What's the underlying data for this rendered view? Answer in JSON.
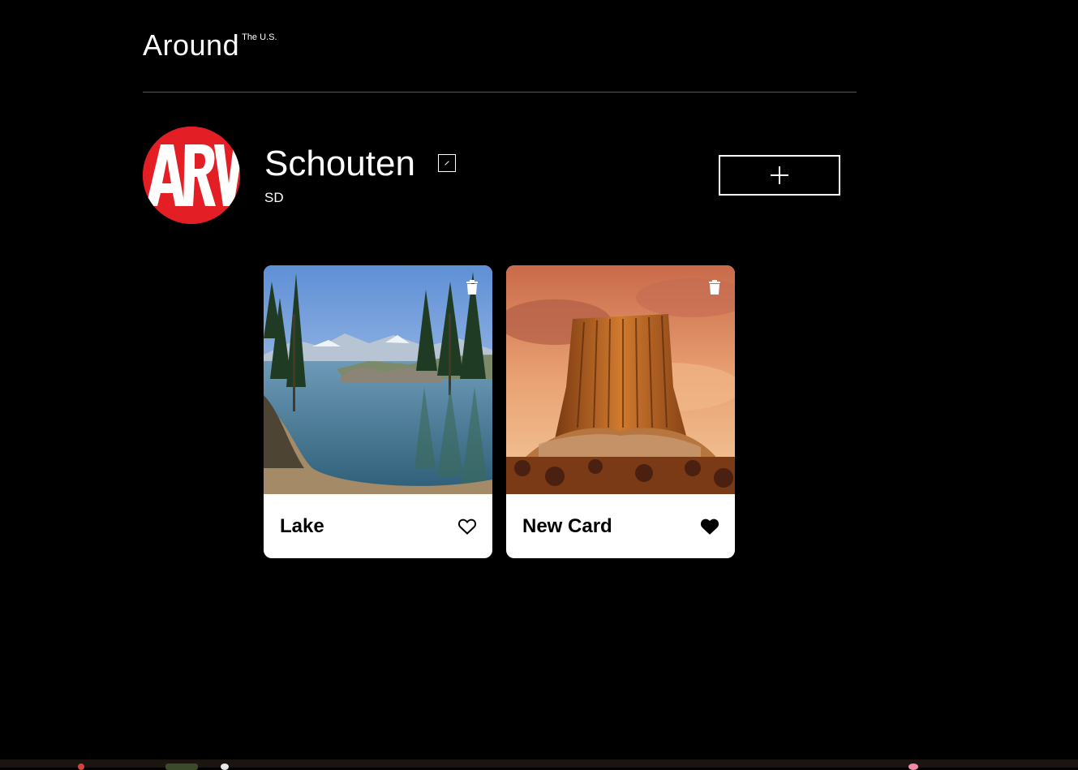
{
  "header": {
    "logo_main": "Around",
    "logo_sup": "The U.S."
  },
  "profile": {
    "name": "Schouten",
    "about": "SD",
    "avatar_text": "ARV",
    "avatar_color": "#e31e24"
  },
  "cards": [
    {
      "title": "Lake",
      "liked": false,
      "image": "lake-scene"
    },
    {
      "title": "New Card",
      "liked": true,
      "image": "rock-tower-scene"
    }
  ],
  "icons": {
    "edit": "pencil-icon",
    "add": "plus-icon",
    "delete": "trash-icon",
    "like": "heart-icon"
  },
  "colors": {
    "background": "#000000",
    "card": "#ffffff",
    "text_dark": "#000000",
    "divider": "#545454"
  }
}
